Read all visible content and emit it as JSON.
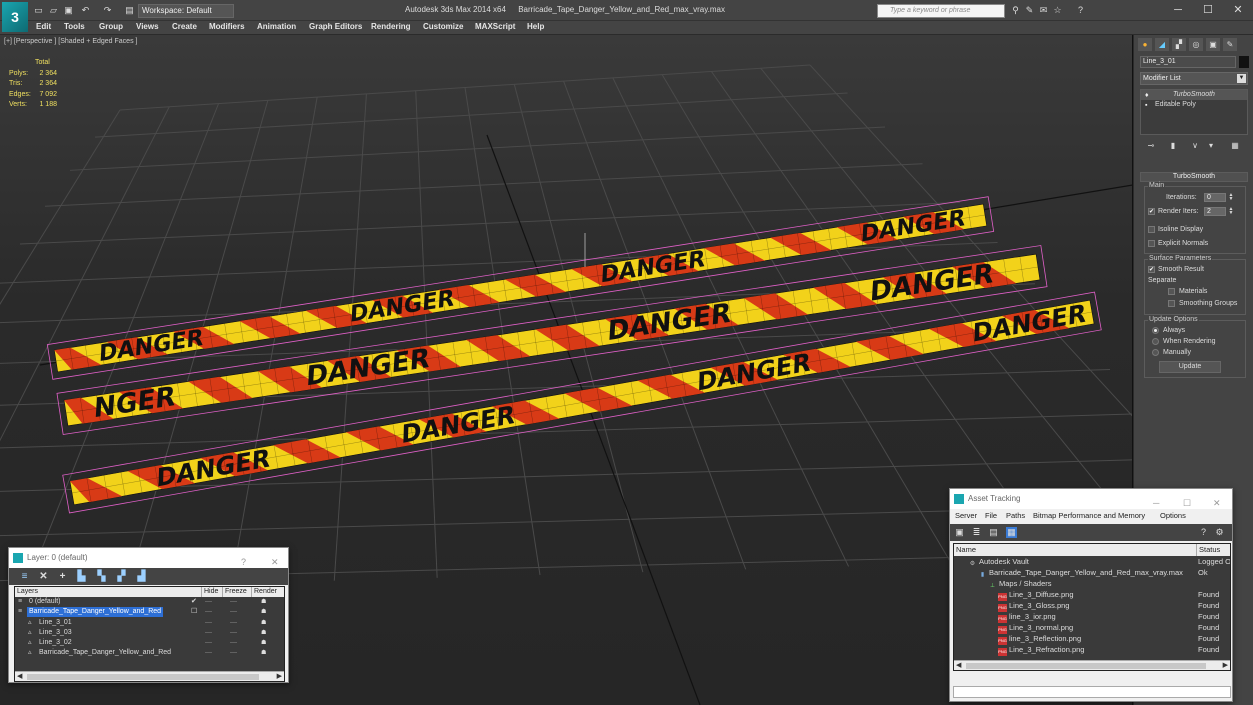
{
  "titlebar": {
    "logo_text": "3",
    "workspace": "Workspace: Default",
    "app_title": "Autodesk 3ds Max  2014 x64",
    "file_name": "Barricade_Tape_Danger_Yellow_and_Red_max_vray.max",
    "search_placeholder": "Type a keyword or phrase",
    "win_min": "─",
    "win_max": "☐",
    "win_close": "✕"
  },
  "menu": [
    "Edit",
    "Tools",
    "Group",
    "Views",
    "Create",
    "Modifiers",
    "Animation",
    "Graph Editors",
    "Rendering",
    "Customize",
    "MAXScript",
    "Help"
  ],
  "viewport": {
    "label": "[+] [Perspective ] [Shaded + Edged Faces ]",
    "stats": {
      "header": "Total",
      "rows": [
        {
          "label": "Polys:",
          "value": "2 364"
        },
        {
          "label": "Tris:",
          "value": "2 364"
        },
        {
          "label": "Edges:",
          "value": "7 092"
        },
        {
          "label": "Verts:",
          "value": "1 188"
        }
      ]
    },
    "tape_word": "DANGER",
    "tape_word_partial": "NGER",
    "colors": {
      "yellow": "#f2d21a",
      "red": "#d83a16",
      "wire": "#e060c8"
    }
  },
  "command_panel": {
    "object_name": "Line_3_01",
    "modifier_list": "Modifier List",
    "stack": [
      "TurboSmooth",
      "Editable Poly"
    ],
    "rollout_title": "TurboSmooth",
    "main_group": "Main",
    "iterations_label": "Iterations:",
    "iterations_value": "0",
    "render_iters_label": "Render Iters:",
    "render_iters_value": "2",
    "isoline_display": "Isoline Display",
    "explicit_normals": "Explicit Normals",
    "surface_group": "Surface Parameters",
    "smooth_result": "Smooth Result",
    "separate": "Separate",
    "materials": "Materials",
    "smoothing_groups": "Smoothing Groups",
    "update_group": "Update Options",
    "always": "Always",
    "when_rendering": "When Rendering",
    "manually": "Manually",
    "update_button": "Update"
  },
  "layer_dialog": {
    "title": "Layer: 0 (default)",
    "help": "?",
    "close": "✕",
    "columns": [
      "Layers",
      "Hide",
      "Freeze",
      "Render"
    ],
    "rows": [
      {
        "name": "0 (default)",
        "indent": 1
      },
      {
        "name": "Barricade_Tape_Danger_Yellow_and_Red",
        "indent": 1,
        "selected": true
      },
      {
        "name": "Line_3_01",
        "indent": 2
      },
      {
        "name": "Line_3_03",
        "indent": 2
      },
      {
        "name": "Line_3_02",
        "indent": 2
      },
      {
        "name": "Barricade_Tape_Danger_Yellow_and_Red",
        "indent": 2
      }
    ],
    "dash": "—"
  },
  "asset_dialog": {
    "title": "Asset Tracking",
    "min": "─",
    "max": "☐",
    "close": "✕",
    "menu": [
      "Server",
      "File",
      "Paths",
      "Bitmap Performance and Memory",
      "Options"
    ],
    "columns": [
      "Name",
      "Status"
    ],
    "rows": [
      {
        "name": "Autodesk Vault",
        "status": "Logged O",
        "indent": 1,
        "icon": "vault"
      },
      {
        "name": "Barricade_Tape_Danger_Yellow_and_Red_max_vray.max",
        "status": "Ok",
        "indent": 2,
        "icon": "file"
      },
      {
        "name": "Maps / Shaders",
        "status": "",
        "indent": 3,
        "icon": "maps"
      },
      {
        "name": "Line_3_Diffuse.png",
        "status": "Found",
        "indent": 4,
        "icon": "png"
      },
      {
        "name": "Line_3_Gloss.png",
        "status": "Found",
        "indent": 4,
        "icon": "png"
      },
      {
        "name": "line_3_ior.png",
        "status": "Found",
        "indent": 4,
        "icon": "png"
      },
      {
        "name": "Line_3_normal.png",
        "status": "Found",
        "indent": 4,
        "icon": "png"
      },
      {
        "name": "line_3_Reflection.png",
        "status": "Found",
        "indent": 4,
        "icon": "png"
      },
      {
        "name": "Line_3_Refraction.png",
        "status": "Found",
        "indent": 4,
        "icon": "png"
      }
    ]
  }
}
